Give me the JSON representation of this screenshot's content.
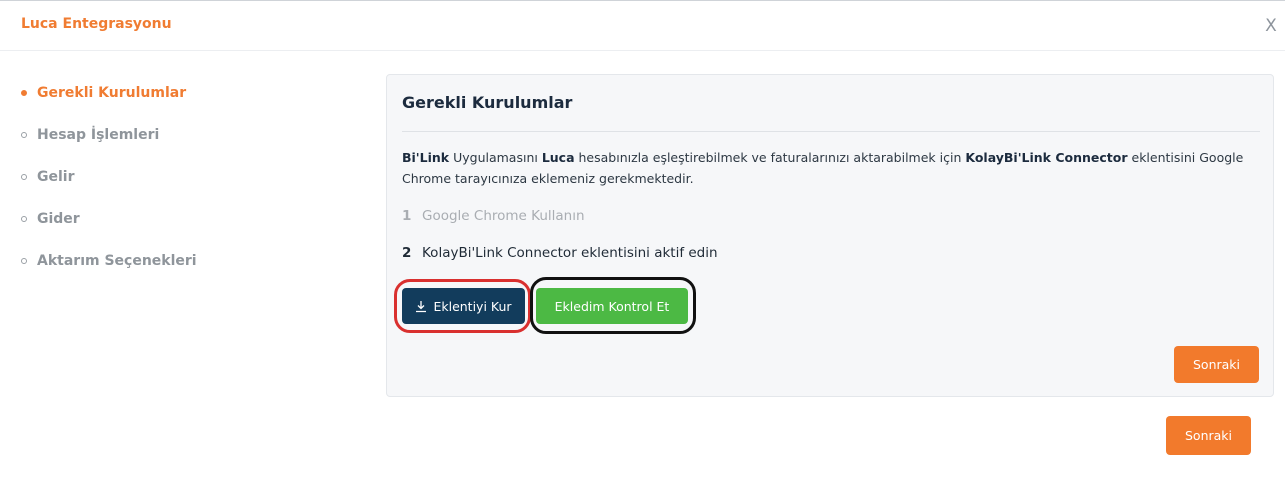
{
  "header": {
    "title": "Luca Entegrasyonu",
    "close_label": "X"
  },
  "steps": [
    {
      "label": "Gerekli Kurulumlar",
      "active": true
    },
    {
      "label": "Hesap İşlemleri",
      "active": false
    },
    {
      "label": "Gelir",
      "active": false
    },
    {
      "label": "Gider",
      "active": false
    },
    {
      "label": "Aktarım Seçenekleri",
      "active": false
    }
  ],
  "panel": {
    "title": "Gerekli Kurulumlar",
    "description": {
      "bold1": "Bi'Link",
      "text1": " Uygulamasını ",
      "bold2": "Luca",
      "text2": " hesabınızla eşleştirebilmek ve faturalarınızı aktarabilmek için ",
      "bold3": "KolayBi'Link Connector",
      "text3": " eklentisini Google Chrome tarayıcınıza eklemeniz gerekmektedir."
    },
    "items": [
      {
        "num": "1",
        "text": "Google Chrome Kullanın"
      },
      {
        "num": "2",
        "text": "KolayBi'Link Connector eklentisini aktif edin"
      }
    ],
    "install_button": "Eklentiyi Kur",
    "check_button": "Ekledim Kontrol Et",
    "next_button": "Sonraki"
  },
  "footer": {
    "next_button": "Sonraki"
  },
  "colors": {
    "accent": "#f07c32",
    "install": "#123c5c",
    "check": "#4cb944",
    "highlight_red": "#d9302f",
    "highlight_black": "#111111"
  }
}
